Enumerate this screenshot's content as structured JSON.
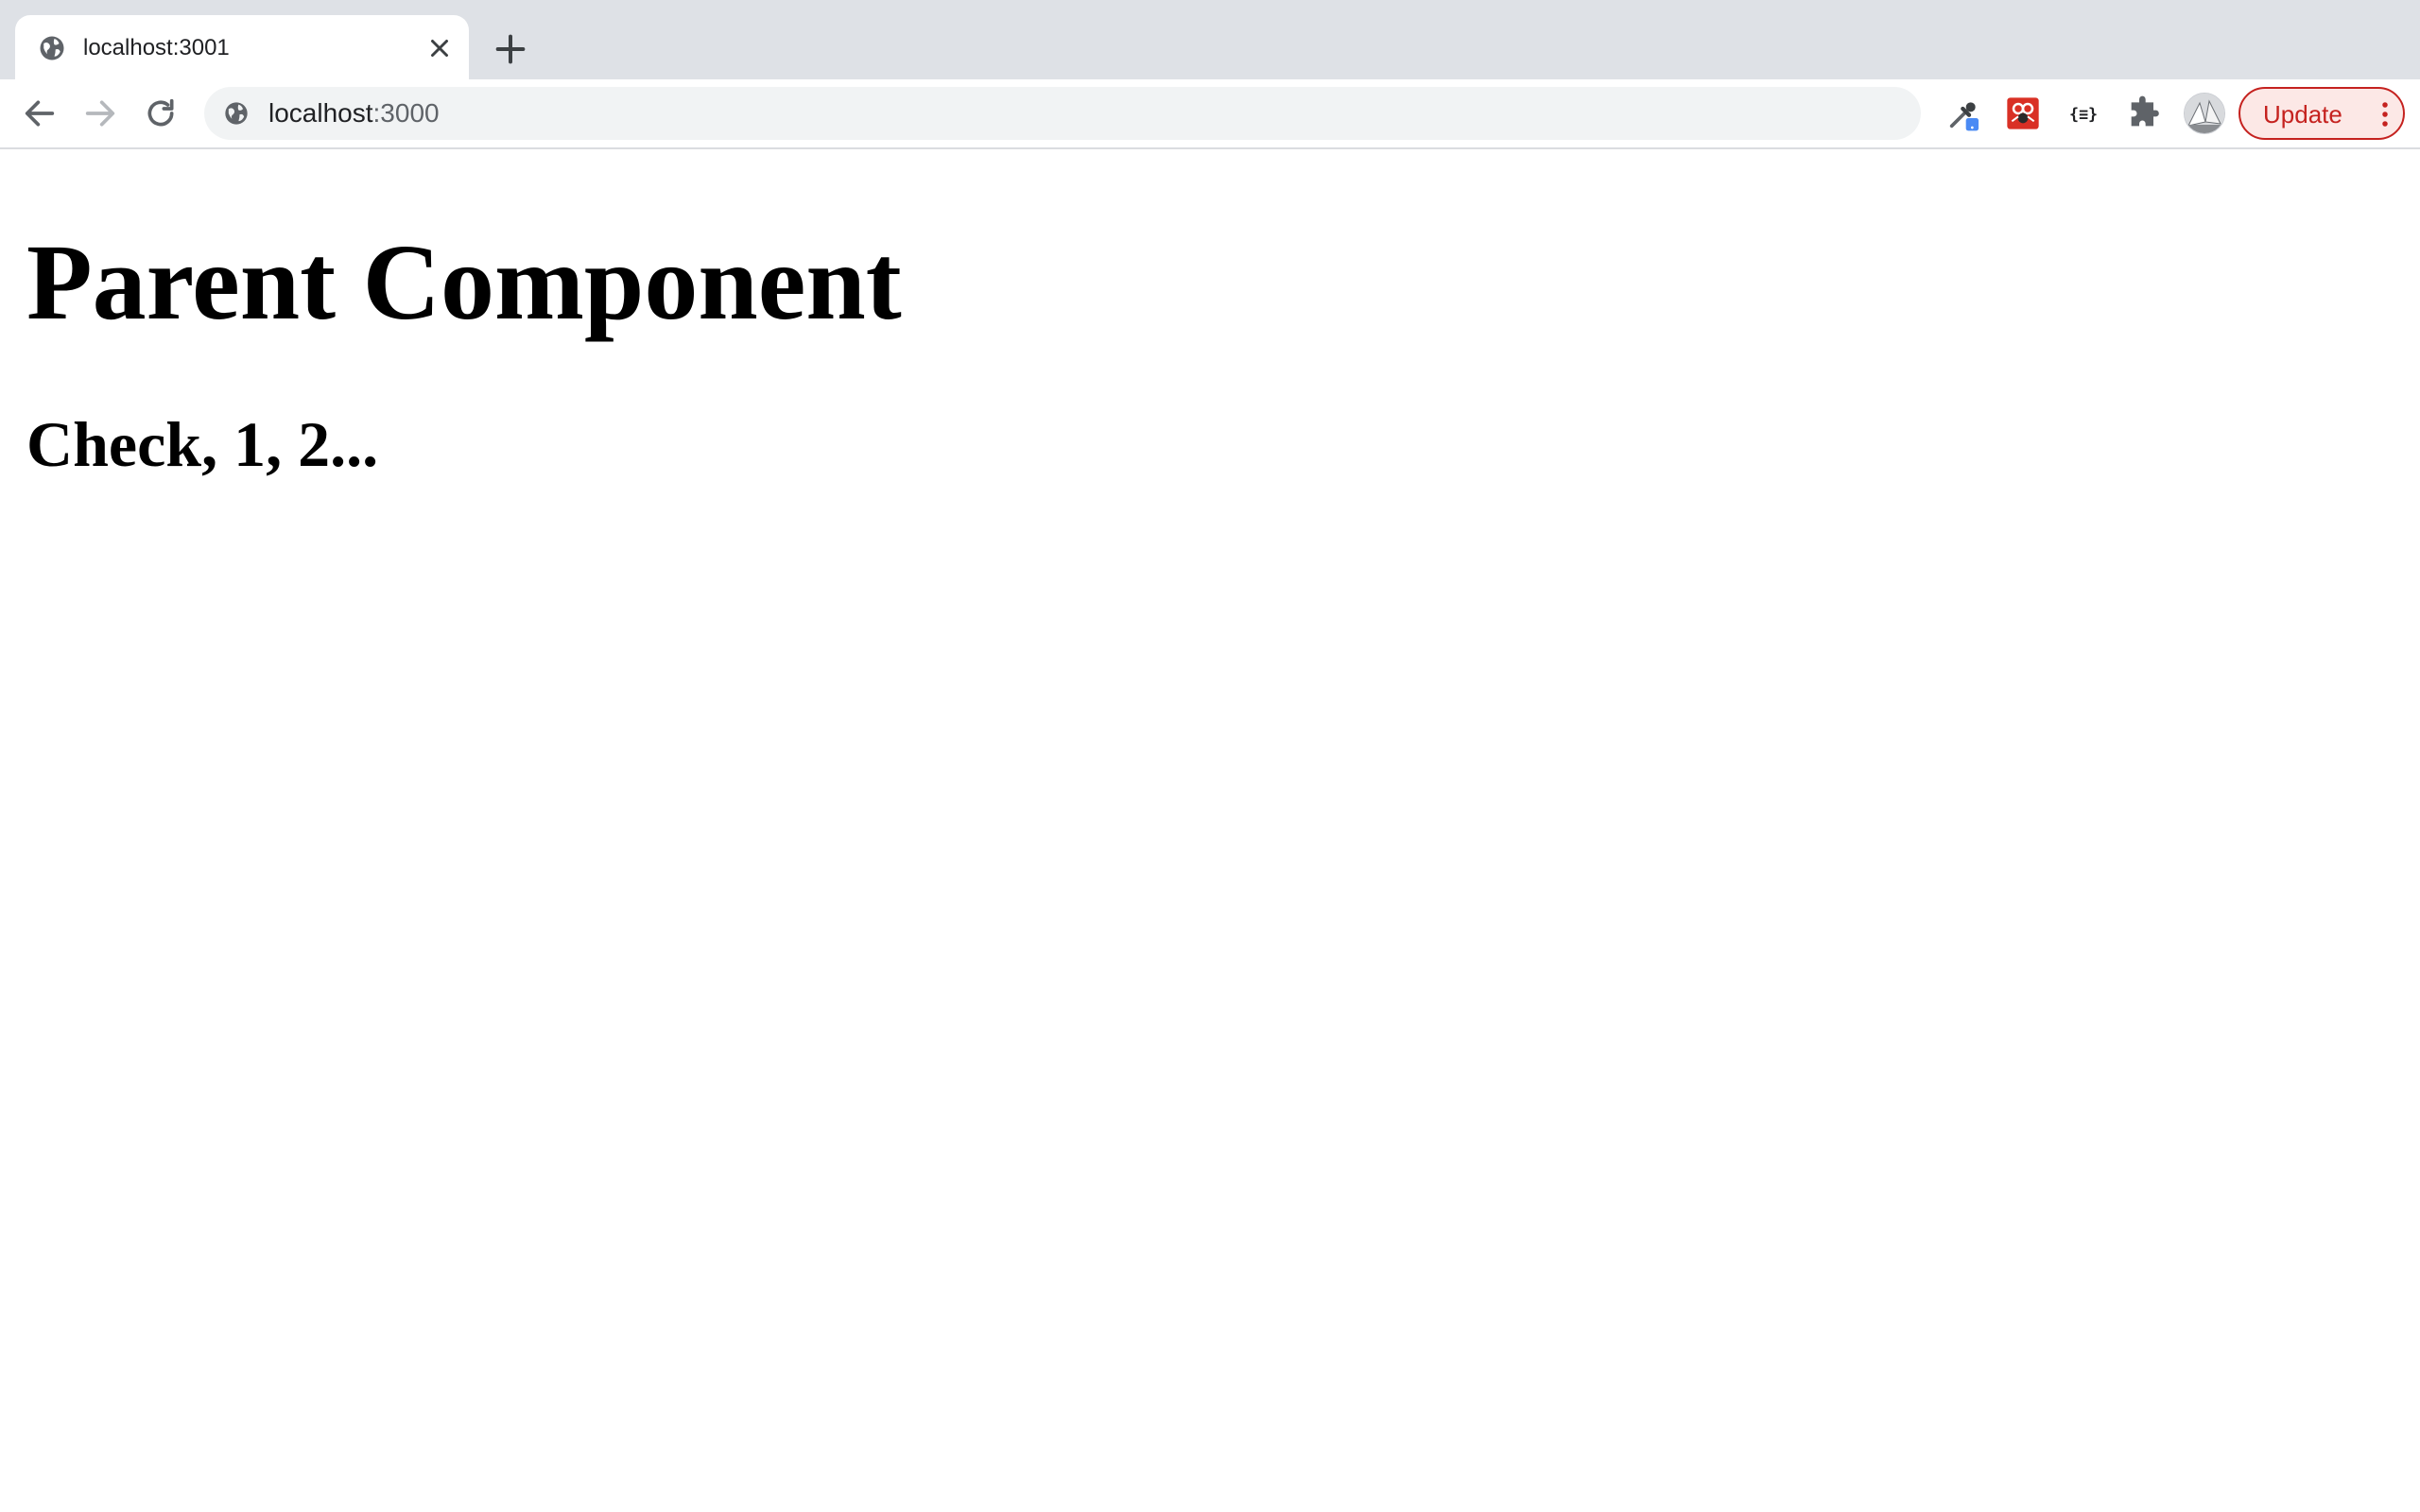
{
  "browser": {
    "tab": {
      "title": "localhost:3001",
      "favicon": "globe-icon"
    },
    "address_bar": {
      "host": "localhost",
      "port": ":3000"
    },
    "update_button": {
      "label": "Update"
    },
    "colors": {
      "update_accent": "#c5221f",
      "tabstrip_bg": "#dee1e6",
      "omnibox_bg": "#f1f3f4"
    }
  },
  "page": {
    "heading": "Parent Component",
    "subheading": "Check, 1, 2..."
  }
}
